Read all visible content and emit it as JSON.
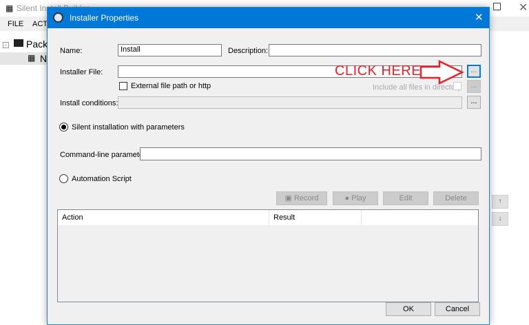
{
  "background_window": {
    "title": "Silent Install Builder",
    "menu": [
      "FILE",
      "ACT"
    ],
    "tree": {
      "root": "Packa",
      "child": "N"
    },
    "side_buttons": [
      "↑",
      "↓"
    ]
  },
  "dialog": {
    "title": "Installer Properties",
    "name_label": "Name:",
    "name_value": "Install",
    "description_label": "Description:",
    "description_value": "",
    "installer_file_label": "Installer File:",
    "installer_file_value": "",
    "browse_label": "...",
    "external_label": "External file path or http",
    "external_checked": false,
    "include_all_label": "Include all files in directory",
    "include_all_checked": false,
    "install_conditions_label": "Install conditions:",
    "silent_label": "Silent installation with parameters",
    "silent_selected": true,
    "cmdline_label": "Command-line parameters:",
    "cmdline_value": "",
    "automation_label": "Automation Script",
    "automation_selected": false,
    "script_buttons": {
      "record": "Record",
      "play": "Play",
      "edit": "Edit",
      "delete": "Delete"
    },
    "table": {
      "columns": [
        "Action",
        "Result",
        ""
      ],
      "rows": []
    },
    "ok": "OK",
    "cancel": "Cancel"
  },
  "annotation": {
    "text": "CLICK HERE",
    "color": "#e8202a"
  },
  "colors": {
    "accent": "#0078d7"
  }
}
